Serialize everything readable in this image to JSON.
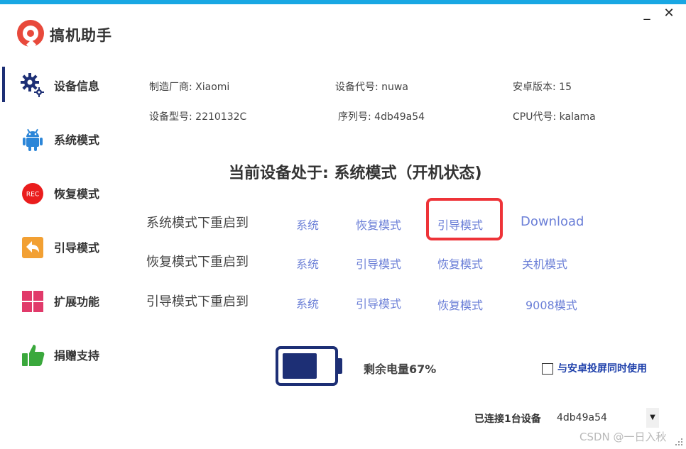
{
  "app": {
    "title": "搞机助手"
  },
  "window": {
    "minimize": "_",
    "close": "✕"
  },
  "sidebar": {
    "items": [
      {
        "label": "设备信息",
        "icon": "gear-icon"
      },
      {
        "label": "系统模式",
        "icon": "android-icon"
      },
      {
        "label": "恢复模式",
        "icon": "rec-icon"
      },
      {
        "label": "引导模式",
        "icon": "back-arrow-icon"
      },
      {
        "label": "扩展功能",
        "icon": "grid-icon"
      },
      {
        "label": "捐赠支持",
        "icon": "thumbs-up-icon"
      }
    ]
  },
  "device": {
    "manufacturer": "制造厂商: Xiaomi",
    "codename": "设备代号: nuwa",
    "android": "安卓版本: 15",
    "model": "设备型号: 2210132C",
    "serial": "序列号: 4db49a54",
    "cpu": "CPU代号: kalama"
  },
  "status": {
    "title": "当前设备处于: 系统模式（开机状态)"
  },
  "reboot_rows": [
    {
      "label": "系统模式下重启到",
      "options": [
        "系统",
        "恢复模式",
        "引导模式",
        "Download"
      ]
    },
    {
      "label": "恢复模式下重启到",
      "options": [
        "系统",
        "引导模式",
        "恢复模式",
        "关机模式"
      ]
    },
    {
      "label": "引导模式下重启到",
      "options": [
        "系统",
        "引导模式",
        "恢复模式",
        "9008模式"
      ]
    }
  ],
  "battery": {
    "text": "剩余电量67%",
    "level": 67
  },
  "screen_mirror": {
    "label": "与安卓投屏同时使用",
    "checked": false
  },
  "connection": {
    "label": "已连接1台设备",
    "selected": "4db49a54"
  },
  "watermark": "CSDN @一日入秋",
  "colors": {
    "accent": "#19a7e3",
    "navy": "#1d2f75",
    "link": "#6b7fd7",
    "highlight": "#ee3338"
  }
}
